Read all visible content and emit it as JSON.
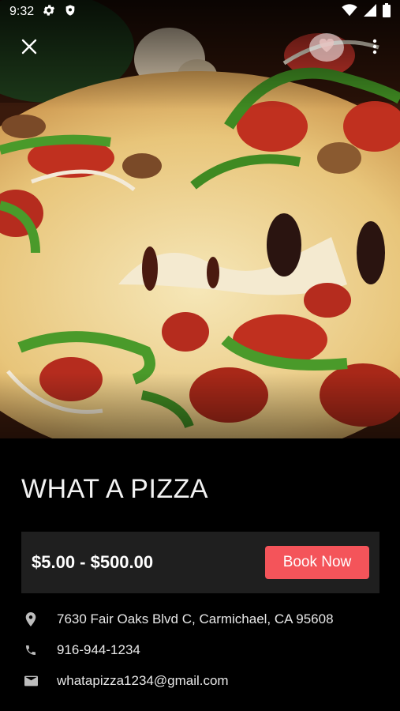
{
  "status_bar": {
    "time": "9:32"
  },
  "icons": {
    "settings": "gear-icon",
    "shield": "shield-icon",
    "wifi": "wifi-icon",
    "signal": "signal-icon",
    "battery": "battery-icon",
    "close": "close-icon",
    "favorite": "heart-icon",
    "more": "more-vert-icon",
    "location": "location-pin-icon",
    "phone": "phone-icon",
    "email": "email-icon"
  },
  "listing": {
    "name": "WHAT A PIZZA",
    "price_range": "$5.00 - $500.00",
    "book_label": "Book Now",
    "address": "7630 Fair Oaks Blvd C, Carmichael, CA 95608",
    "phone": "916-944-1234",
    "email": "whatapizza1234@gmail.com"
  },
  "colors": {
    "accent": "#f4545a",
    "background": "#000000",
    "card": "#1f1f1f"
  }
}
